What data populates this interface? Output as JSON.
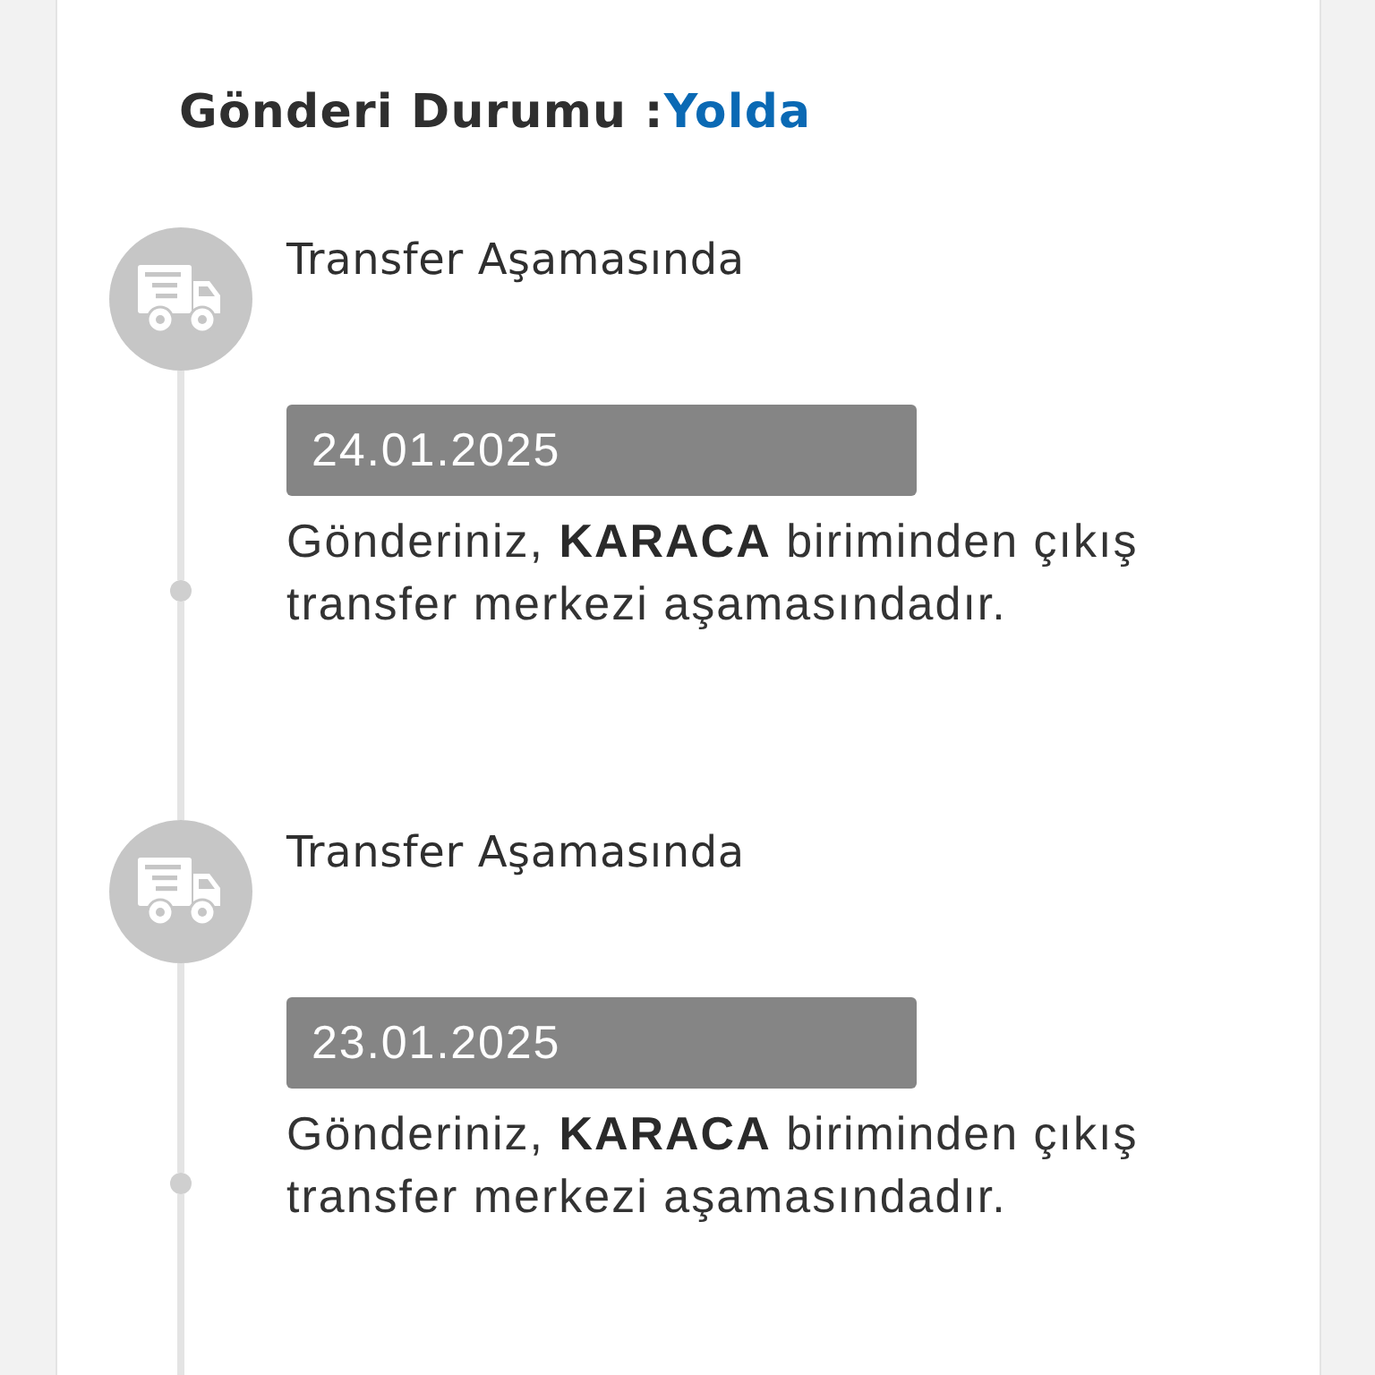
{
  "status": {
    "label": "Gönderi Durumu :",
    "value": "Yolda"
  },
  "events": [
    {
      "title": "Transfer Aşamasında",
      "date": "24.01.2025",
      "description": "Gönderiniz, **KARACA** biriminden çıkış transfer merkezi aşamasındadır."
    },
    {
      "title": "Transfer Aşamasında",
      "date": "23.01.2025",
      "description": "Gönderiniz, **KARACA** biriminden çıkış transfer merkezi aşamasındadır."
    }
  ]
}
